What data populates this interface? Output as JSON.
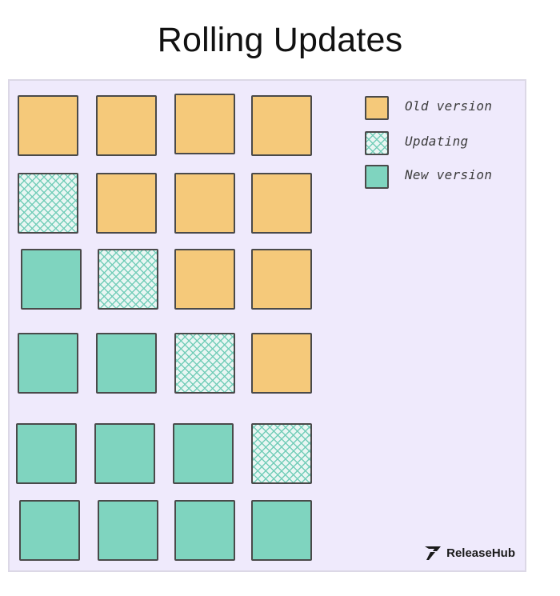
{
  "title": "Rolling Updates",
  "colors": {
    "old": "#f5c97a",
    "new": "#7fd4bf",
    "updating_hatch": "#73cdb8",
    "canvas": "#efeafc",
    "outline": "#4a4a4a"
  },
  "legend": [
    {
      "state": "old",
      "label": "Old version"
    },
    {
      "state": "updating",
      "label": "Updating"
    },
    {
      "state": "new",
      "label": "New version"
    }
  ],
  "grid": [
    [
      "old",
      "old",
      "old",
      "old"
    ],
    [
      "updating",
      "old",
      "old",
      "old"
    ],
    [
      "new",
      "updating",
      "old",
      "old"
    ],
    [
      "new",
      "new",
      "updating",
      "old"
    ],
    [
      "new",
      "new",
      "new",
      "updating"
    ],
    [
      "new",
      "new",
      "new",
      "new"
    ]
  ],
  "brand": {
    "name": "ReleaseHub",
    "icon": "releasehub-logo-icon"
  }
}
